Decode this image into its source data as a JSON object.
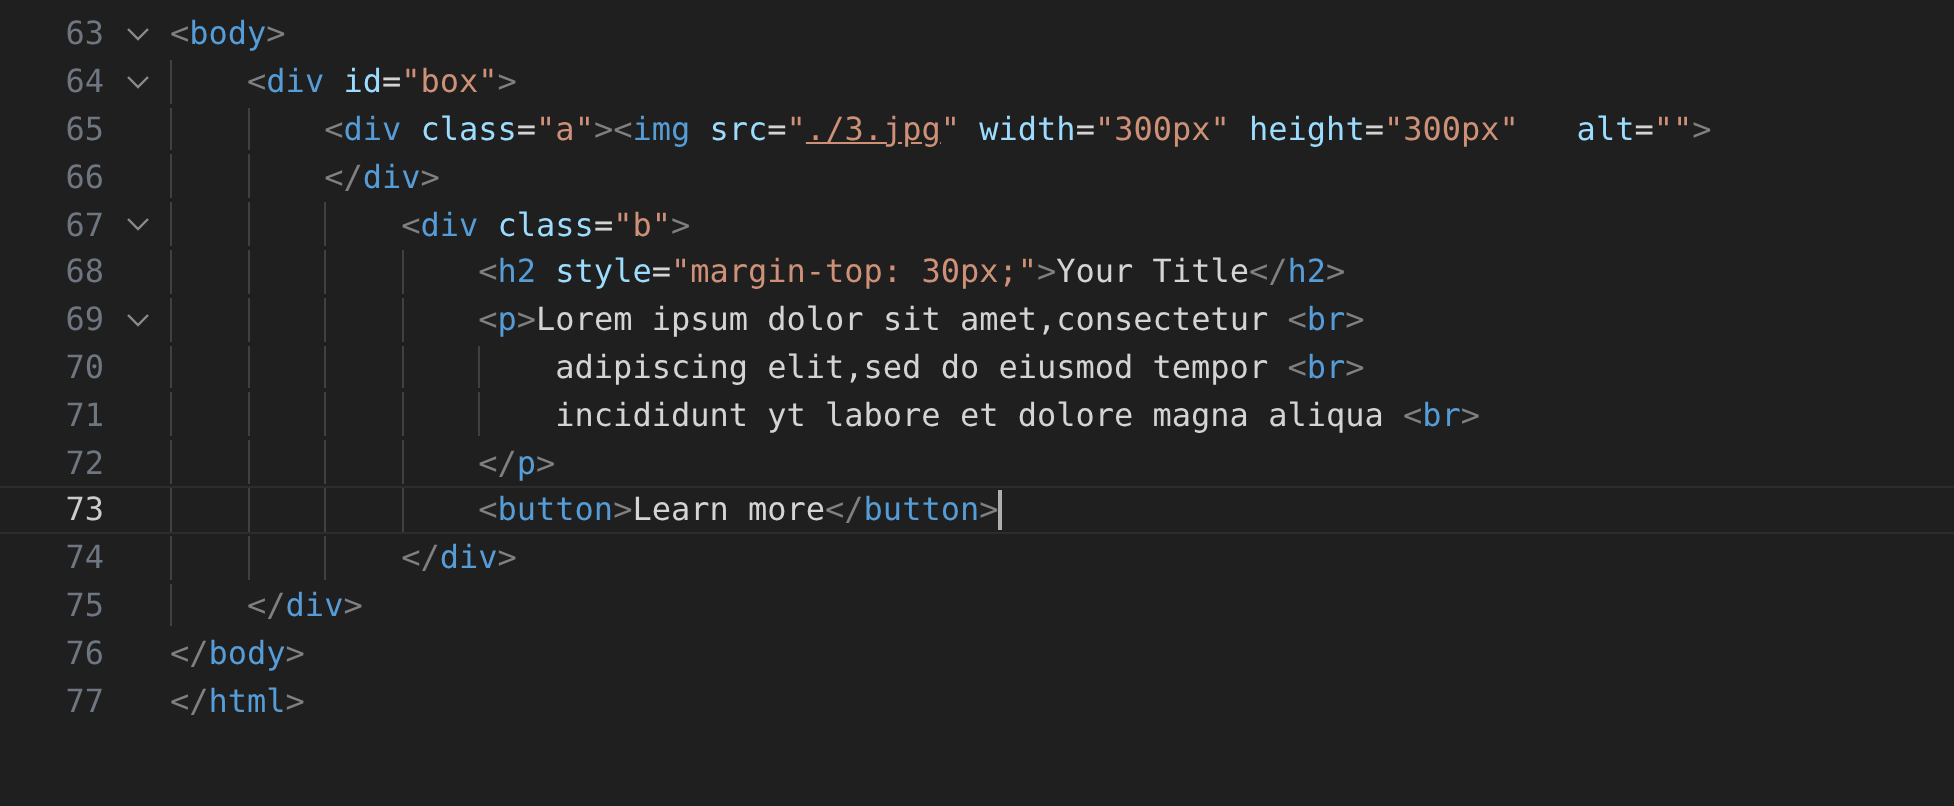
{
  "editor": {
    "lines": [
      {
        "number": "63",
        "foldable": true,
        "current": false,
        "tokens": [
          {
            "kind": "punct",
            "text": "<"
          },
          {
            "kind": "tag",
            "text": "body"
          },
          {
            "kind": "punct",
            "text": ">"
          }
        ]
      },
      {
        "number": "64",
        "foldable": true,
        "current": false,
        "tokens": [
          {
            "kind": "punct",
            "text": "    <"
          },
          {
            "kind": "tag",
            "text": "div"
          },
          {
            "kind": "attr",
            "text": " id"
          },
          {
            "kind": "text",
            "text": "="
          },
          {
            "kind": "string",
            "text": "\"box\""
          },
          {
            "kind": "punct",
            "text": ">"
          }
        ]
      },
      {
        "number": "65",
        "foldable": false,
        "current": false,
        "tokens": [
          {
            "kind": "punct",
            "text": "        <"
          },
          {
            "kind": "tag",
            "text": "div"
          },
          {
            "kind": "attr",
            "text": " class"
          },
          {
            "kind": "text",
            "text": "="
          },
          {
            "kind": "string",
            "text": "\"a\""
          },
          {
            "kind": "punct",
            "text": "><"
          },
          {
            "kind": "tag",
            "text": "img"
          },
          {
            "kind": "attr",
            "text": " src"
          },
          {
            "kind": "text",
            "text": "="
          },
          {
            "kind": "string",
            "text": "\""
          },
          {
            "kind": "link",
            "text": "./3.jpg"
          },
          {
            "kind": "string",
            "text": "\""
          },
          {
            "kind": "attr",
            "text": " width"
          },
          {
            "kind": "text",
            "text": "="
          },
          {
            "kind": "string",
            "text": "\"300px\""
          },
          {
            "kind": "attr",
            "text": " height"
          },
          {
            "kind": "text",
            "text": "="
          },
          {
            "kind": "string",
            "text": "\"300px\""
          },
          {
            "kind": "attr",
            "text": "   alt"
          },
          {
            "kind": "text",
            "text": "="
          },
          {
            "kind": "string",
            "text": "\"\""
          },
          {
            "kind": "punct",
            "text": ">"
          }
        ]
      },
      {
        "number": "66",
        "foldable": false,
        "current": false,
        "tokens": [
          {
            "kind": "punct",
            "text": "        </"
          },
          {
            "kind": "tag",
            "text": "div"
          },
          {
            "kind": "punct",
            "text": ">"
          }
        ]
      },
      {
        "number": "67",
        "foldable": true,
        "current": false,
        "tokens": [
          {
            "kind": "punct",
            "text": "            <"
          },
          {
            "kind": "tag",
            "text": "div"
          },
          {
            "kind": "attr",
            "text": " class"
          },
          {
            "kind": "text",
            "text": "="
          },
          {
            "kind": "string",
            "text": "\"b\""
          },
          {
            "kind": "punct",
            "text": ">"
          }
        ]
      },
      {
        "number": "68",
        "foldable": false,
        "current": false,
        "tokens": [
          {
            "kind": "punct",
            "text": "                <"
          },
          {
            "kind": "tag",
            "text": "h2"
          },
          {
            "kind": "attr",
            "text": " style"
          },
          {
            "kind": "text",
            "text": "="
          },
          {
            "kind": "string",
            "text": "\"margin-top: 30px;\""
          },
          {
            "kind": "punct",
            "text": ">"
          },
          {
            "kind": "text",
            "text": "Your Title"
          },
          {
            "kind": "punct",
            "text": "</"
          },
          {
            "kind": "tag",
            "text": "h2"
          },
          {
            "kind": "punct",
            "text": ">"
          }
        ]
      },
      {
        "number": "69",
        "foldable": true,
        "current": false,
        "tokens": [
          {
            "kind": "punct",
            "text": "                <"
          },
          {
            "kind": "tag",
            "text": "p"
          },
          {
            "kind": "punct",
            "text": ">"
          },
          {
            "kind": "text",
            "text": "Lorem ipsum dolor sit amet,consectetur "
          },
          {
            "kind": "punct",
            "text": "<"
          },
          {
            "kind": "tag",
            "text": "br"
          },
          {
            "kind": "punct",
            "text": ">"
          }
        ]
      },
      {
        "number": "70",
        "foldable": false,
        "current": false,
        "tokens": [
          {
            "kind": "text",
            "text": "                    adipiscing elit,sed do eiusmod tempor "
          },
          {
            "kind": "punct",
            "text": "<"
          },
          {
            "kind": "tag",
            "text": "br"
          },
          {
            "kind": "punct",
            "text": ">"
          }
        ]
      },
      {
        "number": "71",
        "foldable": false,
        "current": false,
        "tokens": [
          {
            "kind": "text",
            "text": "                    incididunt yt labore et dolore magna aliqua "
          },
          {
            "kind": "punct",
            "text": "<"
          },
          {
            "kind": "tag",
            "text": "br"
          },
          {
            "kind": "punct",
            "text": ">"
          }
        ]
      },
      {
        "number": "72",
        "foldable": false,
        "current": false,
        "tokens": [
          {
            "kind": "punct",
            "text": "                </"
          },
          {
            "kind": "tag",
            "text": "p"
          },
          {
            "kind": "punct",
            "text": ">"
          }
        ]
      },
      {
        "number": "73",
        "foldable": false,
        "current": true,
        "tokens": [
          {
            "kind": "punct",
            "text": "                <"
          },
          {
            "kind": "tag",
            "text": "button"
          },
          {
            "kind": "punct",
            "text": ">"
          },
          {
            "kind": "text",
            "text": "Learn more"
          },
          {
            "kind": "punct",
            "text": "</"
          },
          {
            "kind": "tag",
            "text": "button"
          },
          {
            "kind": "punct",
            "text": ">"
          }
        ]
      },
      {
        "number": "74",
        "foldable": false,
        "current": false,
        "tokens": [
          {
            "kind": "punct",
            "text": "            </"
          },
          {
            "kind": "tag",
            "text": "div"
          },
          {
            "kind": "punct",
            "text": ">"
          }
        ]
      },
      {
        "number": "75",
        "foldable": false,
        "current": false,
        "tokens": [
          {
            "kind": "punct",
            "text": "    </"
          },
          {
            "kind": "tag",
            "text": "div"
          },
          {
            "kind": "punct",
            "text": ">"
          }
        ]
      },
      {
        "number": "76",
        "foldable": false,
        "current": false,
        "tokens": [
          {
            "kind": "punct",
            "text": "</"
          },
          {
            "kind": "tag",
            "text": "body"
          },
          {
            "kind": "punct",
            "text": ">"
          }
        ]
      },
      {
        "number": "77",
        "foldable": false,
        "current": false,
        "tokens": [
          {
            "kind": "punct",
            "text": "</"
          },
          {
            "kind": "tag",
            "text": "html"
          },
          {
            "kind": "punct",
            "text": ">"
          }
        ]
      }
    ]
  }
}
